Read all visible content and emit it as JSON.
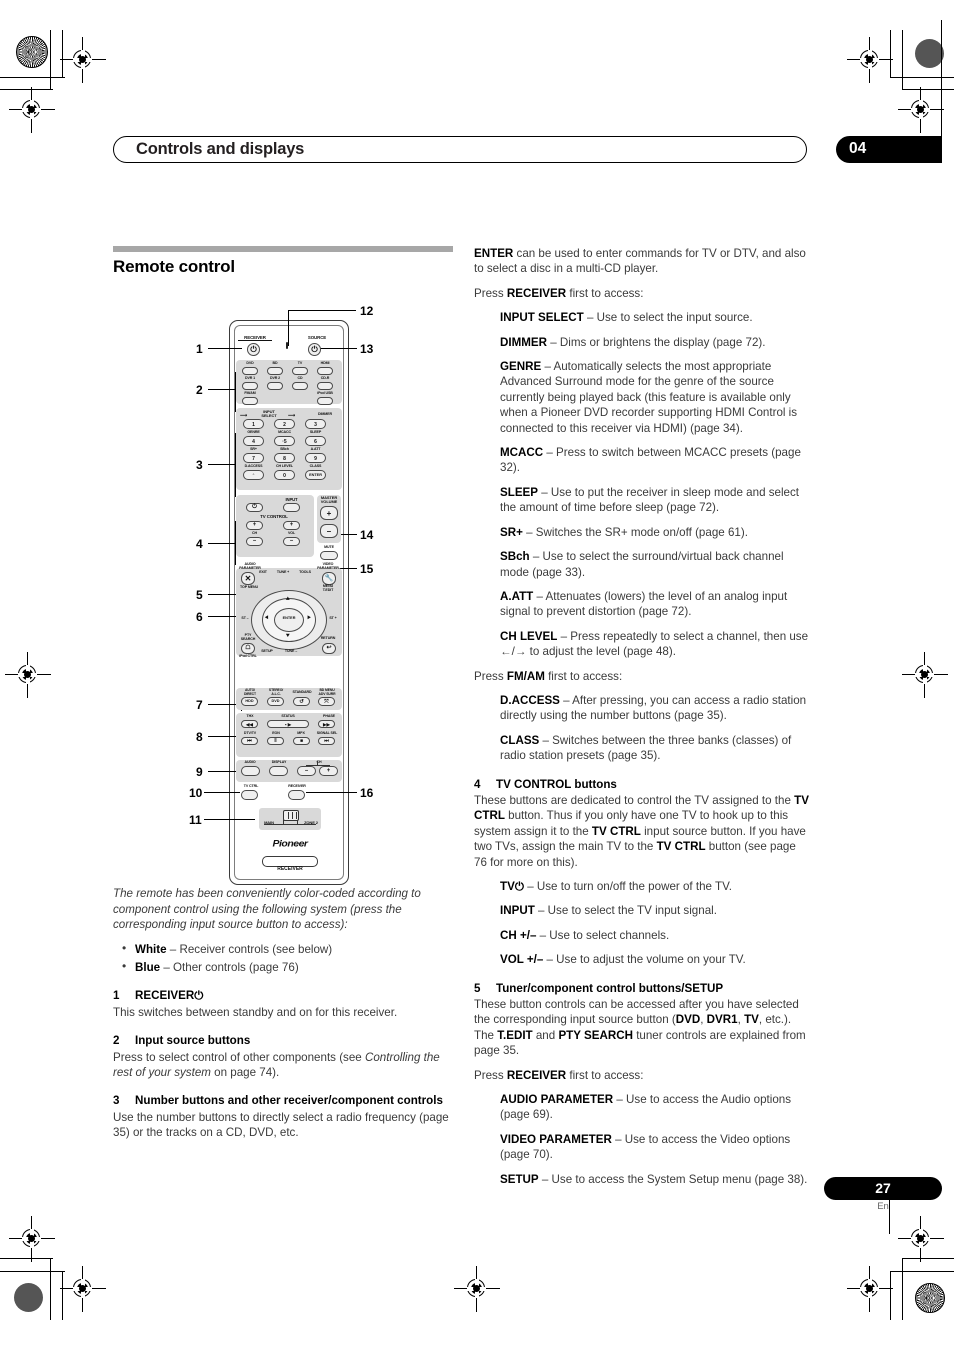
{
  "header": {
    "title": "Controls and displays",
    "chapter": "04"
  },
  "footer": {
    "page": "27",
    "lang": "En"
  },
  "left_column": {
    "section_title": "Remote control",
    "caption_italic": "The remote has been conveniently color-coded according to component control using the following system (press the corresponding input source button to access):",
    "bullets": [
      {
        "bold": "White",
        "rest": " – Receiver controls (see below)"
      },
      {
        "bold": "Blue",
        "rest": " – Other controls (page 76)"
      }
    ],
    "items": [
      {
        "num": "1",
        "head": "RECEIVER⏻",
        "body": "This switches between standby and on for this receiver."
      },
      {
        "num": "2",
        "head": "Input source buttons",
        "body_a": "Press to select control of other components (see ",
        "body_italic": "Controlling the rest of your system",
        "body_b": " on page 74)."
      },
      {
        "num": "3",
        "head": "Number buttons and other receiver/component controls",
        "body": "Use the number buttons to directly select a radio frequency (page 35) or the tracks on a CD, DVD, etc."
      }
    ]
  },
  "right_column": {
    "intro": {
      "bold": "ENTER",
      "rest": " can be used to enter commands for TV or DTV, and also to select a disc in a multi-CD player."
    },
    "press_receiver": {
      "pre": "Press ",
      "bold": "RECEIVER",
      "post": " first to access:"
    },
    "receiver_entries": [
      {
        "term": "INPUT SELECT",
        "desc": " – Use to select the input source."
      },
      {
        "term": "DIMMER",
        "desc": " – Dims or brightens the display (page 72)."
      },
      {
        "term": "GENRE",
        "desc": " – Automatically selects the most appropriate Advanced Surround mode for the genre of the source currently being played back (this feature is available only when a Pioneer DVD recorder supporting HDMI Control is connected to this receiver via HDMI) (page 34)."
      },
      {
        "term": "MCACC",
        "desc": " – Press to switch between MCACC presets (page 32)."
      },
      {
        "term": "SLEEP",
        "desc": " – Use to put the receiver in sleep mode and select the amount of time before sleep (page 72)."
      },
      {
        "term": "SR+",
        "desc": " – Switches the SR+ mode on/off (page 61)."
      },
      {
        "term": "SBch",
        "desc": " – Use to select the surround/virtual back channel mode (page 33)."
      },
      {
        "term": "A.ATT",
        "desc": " – Attenuates (lowers) the level of an analog input signal to prevent distortion (page 72)."
      },
      {
        "term": "CH LEVEL",
        "desc": " – Press repeatedly to select a channel, then use ←/→ to adjust the level (page 48)."
      }
    ],
    "press_fmam": {
      "pre": "Press ",
      "bold": "FM/AM",
      "post": " first to access:"
    },
    "fmam_entries": [
      {
        "term": "D.ACCESS",
        "desc": " – After pressing, you can access a radio station directly using the number buttons (page 35)."
      },
      {
        "term": "CLASS",
        "desc": " – Switches between the three banks (classes) of radio station presets (page 35)."
      }
    ],
    "item4": {
      "num": "4",
      "head": "TV CONTROL buttons",
      "body_parts": [
        {
          "t": "These buttons are dedicated to control the TV assigned to the "
        },
        {
          "t": "TV CTRL",
          "b": true
        },
        {
          "t": " button. Thus if you only have one TV to hook up to this system assign it to the "
        },
        {
          "t": "TV CTRL",
          "b": true
        },
        {
          "t": " input source button. If you have two TVs, assign the main TV to the "
        },
        {
          "t": "TV CTRL",
          "b": true
        },
        {
          "t": " button (see page 76 for more on this)."
        }
      ],
      "entries": [
        {
          "term": "TV⏻",
          "desc": " – Use to turn on/off the power of the TV."
        },
        {
          "term": "INPUT",
          "desc": " – Use to select the TV input signal."
        },
        {
          "term": "CH +/–",
          "desc": " – Use to select channels."
        },
        {
          "term": "VOL +/–",
          "desc": " – Use to adjust the volume on your TV."
        }
      ]
    },
    "item5": {
      "num": "5",
      "head": "Tuner/component control buttons/SETUP",
      "body_parts": [
        {
          "t": "These button controls can be accessed after you have selected the corresponding input source button ("
        },
        {
          "t": "DVD",
          "b": true
        },
        {
          "t": ", "
        },
        {
          "t": "DVR1",
          "b": true
        },
        {
          "t": ", "
        },
        {
          "t": "TV",
          "b": true
        },
        {
          "t": ", etc.). The "
        },
        {
          "t": "T.EDIT",
          "b": true
        },
        {
          "t": " and "
        },
        {
          "t": "PTY SEARCH",
          "b": true
        },
        {
          "t": " tuner controls are explained from page 35."
        }
      ],
      "press_receiver": {
        "pre": "Press ",
        "bold": "RECEIVER",
        "post": " first to access:"
      },
      "entries": [
        {
          "term": "AUDIO PARAMETER",
          "desc": " – Use to access the Audio options (page 69)."
        },
        {
          "term": "VIDEO PARAMETER",
          "desc": " – Use to access the Video options (page 70)."
        },
        {
          "term": "SETUP",
          "desc": " – Use to access the System Setup menu (page 38)."
        }
      ]
    }
  },
  "remote": {
    "callouts": [
      "1",
      "2",
      "3",
      "4",
      "5",
      "6",
      "7",
      "8",
      "9",
      "10",
      "11",
      "12",
      "13",
      "14",
      "15",
      "16"
    ],
    "power_row": {
      "left_label": "RECEIVER",
      "right_label": "SOURCE",
      "icon": "power-icon"
    },
    "source_buttons": [
      [
        "DVD",
        "BD",
        "TV",
        "HDMI"
      ],
      [
        "DVR 1",
        "DVR 2",
        "CD",
        "CD-R"
      ],
      [
        "FM/AM",
        "",
        "",
        "iPod USB"
      ]
    ],
    "numpad": {
      "top_label": "INPUT SELECT",
      "rows": [
        [
          {
            "over": "",
            "key": "1"
          },
          {
            "over": "",
            "key": "2"
          },
          {
            "over": "DIMMER",
            "key": "3"
          }
        ],
        [
          {
            "over": "GENRE",
            "key": "4"
          },
          {
            "over": "MCACC",
            "key": "·5"
          },
          {
            "over": "SLEEP",
            "key": "6"
          }
        ],
        [
          {
            "over": "SR+",
            "key": "7"
          },
          {
            "over": "SBch",
            "key": "8"
          },
          {
            "over": "A.ATT",
            "key": "9"
          }
        ],
        [
          {
            "over": "D.ACCESS",
            "key": "◦"
          },
          {
            "over": "CH LEVEL",
            "key": "0"
          },
          {
            "over": "CLASS",
            "key": "ENTER"
          }
        ]
      ]
    },
    "tv_control": {
      "title": "TV CONTROL",
      "power": "⏻",
      "input": "INPUT",
      "ch_label": "CH",
      "vol_label": "VOL",
      "plus": "+",
      "minus": "–"
    },
    "master_volume": {
      "label": "MASTER VOLUME",
      "plus": "+",
      "minus": "–"
    },
    "mute": "MUTE",
    "audio_parameter": "AUDIO PARAMETER",
    "video_parameter": "VIDEO PARAMETER",
    "exit": "EXIT",
    "tune_plus": "TUNE +",
    "tools": "TOOLS",
    "top_menu": "TOP MENU",
    "menu_tedit": "MENU T.EDIT",
    "st_minus": "ST –",
    "st_plus": "ST +",
    "enter": "ENTER",
    "pty_search": "PTY SEARCH",
    "return": "RETURN",
    "setup": "SETUP",
    "tune_minus": "TUNE –",
    "ipod_ctrl": "iPod CTRL",
    "mode_row": [
      {
        "over": "AUTO/ DIRECT",
        "key": "HDD"
      },
      {
        "over": "STEREO/ A.L.C.",
        "key": "DVD"
      },
      {
        "over": "STANDARD",
        "key": "↺"
      },
      {
        "over": "BD MENU ADV SURR",
        "key": "⤧"
      }
    ],
    "transport_row1": [
      {
        "over": "THX",
        "key": "◀◀"
      },
      {
        "over": "STATUS",
        "key": "▪ ▶"
      },
      {
        "over": "PHASE",
        "key": "▶▶"
      }
    ],
    "transport_row2": [
      {
        "over": "DTV/TV",
        "key": "⏮"
      },
      {
        "over": "EON",
        "key": "‖"
      },
      {
        "over": "MPX",
        "key": "■"
      },
      {
        "over": "SIGNAL SEL",
        "key": "⏭"
      }
    ],
    "audio_display_ch": {
      "audio": "AUDIO",
      "display": "DISPLAY",
      "ch": "CH",
      "minus": "–",
      "plus": "+"
    },
    "tv_ctrl": "TV CTRL",
    "receiver_btn": "RECEIVER",
    "zone_switch": {
      "left": "MAIN",
      "right": "ZONE 2"
    },
    "brand": "Pioneer",
    "bottom_badge": "RECEIVER"
  }
}
